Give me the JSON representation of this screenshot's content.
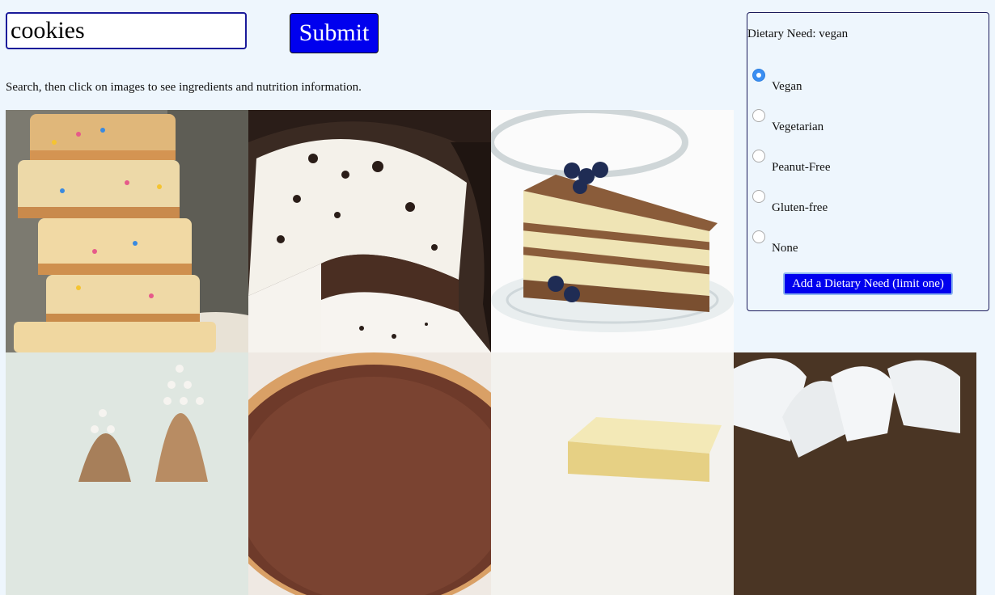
{
  "search": {
    "value": "cookies",
    "submit_label": "Submit"
  },
  "instructions": "Search, then click on images to see ingredients and nutrition information.",
  "dietary_panel": {
    "status": "Dietary Need: vegan",
    "options": [
      {
        "label": "Vegan",
        "checked": true
      },
      {
        "label": "Vegetarian",
        "checked": false
      },
      {
        "label": "Peanut-Free",
        "checked": false
      },
      {
        "label": "Gluten-free",
        "checked": false
      },
      {
        "label": "None",
        "checked": false
      }
    ],
    "add_label": "Add a Dietary Need (limit one)"
  },
  "results": [
    {
      "depicts": "stacked-funfetti-bars"
    },
    {
      "depicts": "chocolate-cream-pie"
    },
    {
      "depicts": "blueberry-cheesecake-slice"
    },
    {
      "depicts": "powdered-cookie-trees"
    },
    {
      "depicts": "chocolate-tart"
    },
    {
      "depicts": "lemon-bar-square"
    },
    {
      "depicts": "meringue-piping"
    }
  ],
  "colors": {
    "accent": "#0000ee",
    "background": "#eef6fd",
    "radio_checked": "#3a8ef2"
  }
}
